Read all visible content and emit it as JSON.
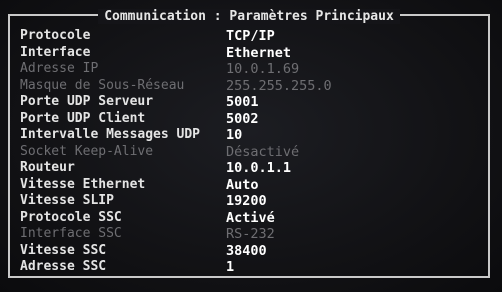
{
  "title": "Communication : Paramètres Principaux",
  "rows": [
    {
      "label": "Protocole",
      "value": "TCP/IP",
      "dim": false
    },
    {
      "label": "Interface",
      "value": "Ethernet",
      "dim": false
    },
    {
      "label": "Adresse IP",
      "value": "10.0.1.69",
      "dim": true
    },
    {
      "label": "Masque de Sous-Réseau",
      "value": "255.255.255.0",
      "dim": true
    },
    {
      "label": "Porte UDP Serveur",
      "value": "5001",
      "dim": false
    },
    {
      "label": "Porte UDP Client",
      "value": "5002",
      "dim": false
    },
    {
      "label": "Intervalle Messages UDP",
      "value": "10",
      "dim": false
    },
    {
      "label": "Socket Keep-Alive",
      "value": "Désactivé",
      "dim": true
    },
    {
      "label": "Routeur",
      "value": "10.0.1.1",
      "dim": false
    },
    {
      "label": "Vitesse Ethernet",
      "value": "Auto",
      "dim": false
    },
    {
      "label": "Vitesse SLIP",
      "value": "19200",
      "dim": false
    },
    {
      "label": "Protocole SSC",
      "value": "Activé",
      "dim": false
    },
    {
      "label": "Interface SSC",
      "value": "RS-232",
      "dim": true
    },
    {
      "label": "Vitesse SSC",
      "value": "38400",
      "dim": false
    },
    {
      "label": "Adresse SSC",
      "value": "1",
      "dim": false
    }
  ]
}
